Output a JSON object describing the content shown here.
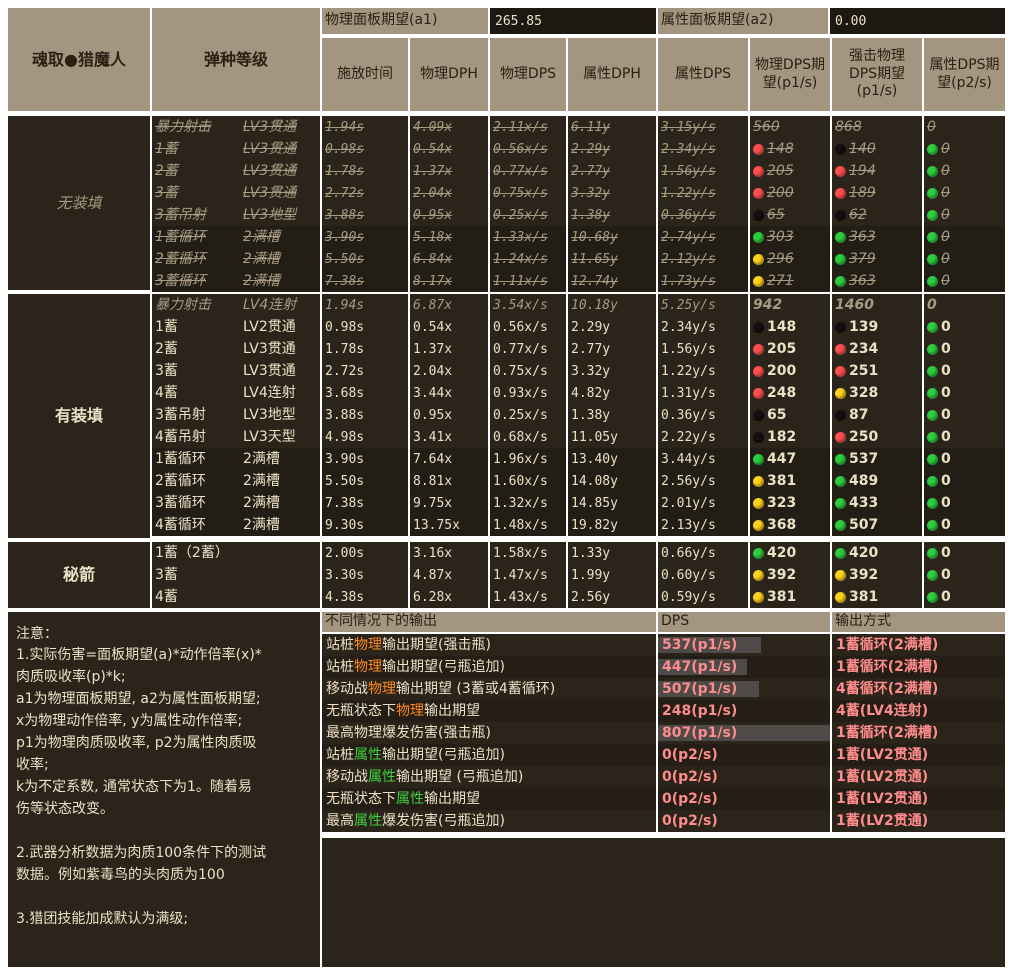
{
  "top": {
    "label_a1": "物理面板期望(a1)",
    "value_a1": "265.85",
    "label_a2": "属性面板期望(a2)",
    "value_a2": "0.00"
  },
  "headers": {
    "weapon": "魂取●猎魔人",
    "ammo": "弹种等级",
    "cols": [
      "施放时间",
      "物理DPH",
      "物理DPS",
      "属性DPH",
      "属性DPS",
      "物理DPS期望(p1/s)",
      "强击物理DPS期望(p1/s)",
      "属性DPS期望(p2/s)"
    ]
  },
  "groups": {
    "no_load": "无装填",
    "load": "有装填",
    "secret": "秘箭"
  },
  "colors": {
    "red": "#ff5050",
    "green": "#2ecc40",
    "yellow": "#ffd21e",
    "black": "#111111",
    "pink_text": "#ff8c8c",
    "orange": "#ff8a1e",
    "green_text": "#3fd03f"
  },
  "rows_no_load": [
    {
      "a": "暴力射击",
      "b": "LV3贯通",
      "t": "1.94s",
      "d1": "4.09x",
      "s1": "2.11x/s",
      "d2": "6.11y",
      "s2": "3.15y/s",
      "p1": "560",
      "k1": "",
      "p2": "868",
      "k2": "",
      "p3": "0",
      "k3": ""
    },
    {
      "a": "1蓄",
      "b": "LV3贯通",
      "t": "0.98s",
      "d1": "0.54x",
      "s1": "0.56x/s",
      "d2": "2.29y",
      "s2": "2.34y/s",
      "p1": "148",
      "k1": "red",
      "p2": "140",
      "k2": "black",
      "p3": "0",
      "k3": "green"
    },
    {
      "a": "2蓄",
      "b": "LV3贯通",
      "t": "1.78s",
      "d1": "1.37x",
      "s1": "0.77x/s",
      "d2": "2.77y",
      "s2": "1.56y/s",
      "p1": "205",
      "k1": "red",
      "p2": "194",
      "k2": "red",
      "p3": "0",
      "k3": "green"
    },
    {
      "a": "3蓄",
      "b": "LV3贯通",
      "t": "2.72s",
      "d1": "2.04x",
      "s1": "0.75x/s",
      "d2": "3.32y",
      "s2": "1.22y/s",
      "p1": "200",
      "k1": "red",
      "p2": "189",
      "k2": "red",
      "p3": "0",
      "k3": "green"
    },
    {
      "a": "3蓄吊射",
      "b": "LV3地型",
      "t": "3.88s",
      "d1": "0.95x",
      "s1": "0.25x/s",
      "d2": "1.38y",
      "s2": "0.36y/s",
      "p1": "65",
      "k1": "black",
      "p2": "62",
      "k2": "black",
      "p3": "0",
      "k3": "green"
    },
    {
      "a": "1蓄循环",
      "b": "2满槽",
      "t": "3.90s",
      "d1": "5.18x",
      "s1": "1.33x/s",
      "d2": "10.68y",
      "s2": "2.74y/s",
      "p1": "303",
      "k1": "green",
      "p2": "363",
      "k2": "green",
      "p3": "0",
      "k3": "green"
    },
    {
      "a": "2蓄循环",
      "b": "2满槽",
      "t": "5.50s",
      "d1": "6.84x",
      "s1": "1.24x/s",
      "d2": "11.65y",
      "s2": "2.12y/s",
      "p1": "296",
      "k1": "yellow",
      "p2": "379",
      "k2": "green",
      "p3": "0",
      "k3": "green"
    },
    {
      "a": "3蓄循环",
      "b": "2满槽",
      "t": "7.38s",
      "d1": "8.17x",
      "s1": "1.11x/s",
      "d2": "12.74y",
      "s2": "1.73y/s",
      "p1": "271",
      "k1": "yellow",
      "p2": "363",
      "k2": "green",
      "p3": "0",
      "k3": "green"
    }
  ],
  "rows_load": [
    {
      "a": "暴力射击",
      "b": "LV4连射",
      "t": "1.94s",
      "d1": "6.87x",
      "s1": "3.54x/s",
      "d2": "10.18y",
      "s2": "5.25y/s",
      "p1": "942",
      "k1": "",
      "p2": "1460",
      "k2": "",
      "p3": "0",
      "k3": ""
    },
    {
      "a": "1蓄",
      "b": "LV2贯通",
      "t": "0.98s",
      "d1": "0.54x",
      "s1": "0.56x/s",
      "d2": "2.29y",
      "s2": "2.34y/s",
      "p1": "148",
      "k1": "black",
      "p2": "139",
      "k2": "black",
      "p3": "0",
      "k3": "green"
    },
    {
      "a": "2蓄",
      "b": "LV3贯通",
      "t": "1.78s",
      "d1": "1.37x",
      "s1": "0.77x/s",
      "d2": "2.77y",
      "s2": "1.56y/s",
      "p1": "205",
      "k1": "red",
      "p2": "234",
      "k2": "red",
      "p3": "0",
      "k3": "green"
    },
    {
      "a": "3蓄",
      "b": "LV3贯通",
      "t": "2.72s",
      "d1": "2.04x",
      "s1": "0.75x/s",
      "d2": "3.32y",
      "s2": "1.22y/s",
      "p1": "200",
      "k1": "red",
      "p2": "251",
      "k2": "red",
      "p3": "0",
      "k3": "green"
    },
    {
      "a": "4蓄",
      "b": "LV4连射",
      "t": "3.68s",
      "d1": "3.44x",
      "s1": "0.93x/s",
      "d2": "4.82y",
      "s2": "1.31y/s",
      "p1": "248",
      "k1": "red",
      "p2": "328",
      "k2": "yellow",
      "p3": "0",
      "k3": "green"
    },
    {
      "a": "3蓄吊射",
      "b": "LV3地型",
      "t": "3.88s",
      "d1": "0.95x",
      "s1": "0.25x/s",
      "d2": "1.38y",
      "s2": "0.36y/s",
      "p1": "65",
      "k1": "black",
      "p2": "87",
      "k2": "black",
      "p3": "0",
      "k3": "green"
    },
    {
      "a": "4蓄吊射",
      "b": "LV3天型",
      "t": "4.98s",
      "d1": "3.41x",
      "s1": "0.68x/s",
      "d2": "11.05y",
      "s2": "2.22y/s",
      "p1": "182",
      "k1": "black",
      "p2": "250",
      "k2": "red",
      "p3": "0",
      "k3": "green"
    },
    {
      "a": "1蓄循环",
      "b": "2满槽",
      "t": "3.90s",
      "d1": "7.64x",
      "s1": "1.96x/s",
      "d2": "13.40y",
      "s2": "3.44y/s",
      "p1": "447",
      "k1": "green",
      "p2": "537",
      "k2": "green",
      "p3": "0",
      "k3": "green"
    },
    {
      "a": "2蓄循环",
      "b": "2满槽",
      "t": "5.50s",
      "d1": "8.81x",
      "s1": "1.60x/s",
      "d2": "14.08y",
      "s2": "2.56y/s",
      "p1": "381",
      "k1": "yellow",
      "p2": "489",
      "k2": "green",
      "p3": "0",
      "k3": "green"
    },
    {
      "a": "3蓄循环",
      "b": "2满槽",
      "t": "7.38s",
      "d1": "9.75x",
      "s1": "1.32x/s",
      "d2": "14.85y",
      "s2": "2.01y/s",
      "p1": "323",
      "k1": "yellow",
      "p2": "433",
      "k2": "green",
      "p3": "0",
      "k3": "green"
    },
    {
      "a": "4蓄循环",
      "b": "2满槽",
      "t": "9.30s",
      "d1": "13.75x",
      "s1": "1.48x/s",
      "d2": "19.82y",
      "s2": "2.13y/s",
      "p1": "368",
      "k1": "yellow",
      "p2": "507",
      "k2": "green",
      "p3": "0",
      "k3": "green"
    }
  ],
  "rows_secret": [
    {
      "a": "1蓄（2蓄）",
      "b": "",
      "t": "2.00s",
      "d1": "3.16x",
      "s1": "1.58x/s",
      "d2": "1.33y",
      "s2": "0.66y/s",
      "p1": "420",
      "k1": "green",
      "p2": "420",
      "k2": "green",
      "p3": "0",
      "k3": "green"
    },
    {
      "a": "3蓄",
      "b": "",
      "t": "3.30s",
      "d1": "4.87x",
      "s1": "1.47x/s",
      "d2": "1.99y",
      "s2": "0.60y/s",
      "p1": "392",
      "k1": "yellow",
      "p2": "392",
      "k2": "yellow",
      "p3": "0",
      "k3": "green"
    },
    {
      "a": "4蓄",
      "b": "",
      "t": "4.38s",
      "d1": "6.28x",
      "s1": "1.43x/s",
      "d2": "2.56y",
      "s2": "0.59y/s",
      "p1": "381",
      "k1": "yellow",
      "p2": "381",
      "k2": "yellow",
      "p3": "0",
      "k3": "green"
    }
  ],
  "notes": {
    "title": "注意：",
    "lines": [
      "1.实际伤害=面板期望(a)*动作倍率(x)*",
      "肉质吸收率(p)*k;",
      "a1为物理面板期望, a2为属性面板期望;",
      "x为物理动作倍率, y为属性动作倍率;",
      "p1为物理肉质吸收率, p2为属性肉质吸",
      "收率;",
      "k为不定系数, 通常状态下为1。随着易",
      "伤等状态改变。",
      "",
      "2.武器分析数据为肉质100条件下的测试",
      "数据。例如紫毒鸟的头肉质为100",
      "",
      "3.猎团技能加成默认为满级;"
    ]
  },
  "summary": {
    "headers": [
      "不同情况下的输出",
      "DPS",
      "输出方式"
    ],
    "rows": [
      {
        "pre": "站桩",
        "kw": "物理",
        "post": "输出期望(强击瓶)",
        "kind": "phys",
        "dps": "537(p1/s)",
        "frac": 0.6,
        "mode": "1蓄循环(2满槽)"
      },
      {
        "pre": "站桩",
        "kw": "物理",
        "post": "输出期望(弓瓶追加)",
        "kind": "phys",
        "dps": "447(p1/s)",
        "frac": 0.52,
        "mode": "1蓄循环(2满槽)"
      },
      {
        "pre": "移动战",
        "kw": "物理",
        "post": "输出期望 (3蓄或4蓄循环)",
        "kind": "phys",
        "dps": "507(p1/s)",
        "frac": 0.59,
        "mode": "4蓄循环(2满槽)"
      },
      {
        "pre": "无瓶状态下",
        "kw": "物理",
        "post": "输出期望",
        "kind": "phys",
        "dps": "248(p1/s)",
        "frac": 0,
        "mode": "4蓄(LV4连射)"
      },
      {
        "pre": "最高物理爆发伤害(强击瓶)",
        "kw": "",
        "post": "",
        "kind": "phys",
        "dps": "807(p1/s)",
        "frac": 1,
        "mode": "1蓄循环(2满槽)"
      },
      {
        "pre": "站桩",
        "kw": "属性",
        "post": "输出期望(弓瓶追加)",
        "kind": "elem",
        "dps": "0(p2/s)",
        "frac": 0,
        "mode": "1蓄(LV2贯通)"
      },
      {
        "pre": "移动战",
        "kw": "属性",
        "post": "输出期望 (弓瓶追加)",
        "kind": "elem",
        "dps": "0(p2/s)",
        "frac": 0,
        "mode": "1蓄(LV2贯通)"
      },
      {
        "pre": "无瓶状态下",
        "kw": "属性",
        "post": "输出期望",
        "kind": "elem",
        "dps": "0(p2/s)",
        "frac": 0,
        "mode": "1蓄(LV2贯通)"
      },
      {
        "pre": "最高",
        "kw": "属性",
        "post": "爆发伤害(弓瓶追加)",
        "kind": "elem",
        "dps": "0(p2/s)",
        "frac": 0,
        "mode": "1蓄(LV2贯通)"
      }
    ]
  }
}
